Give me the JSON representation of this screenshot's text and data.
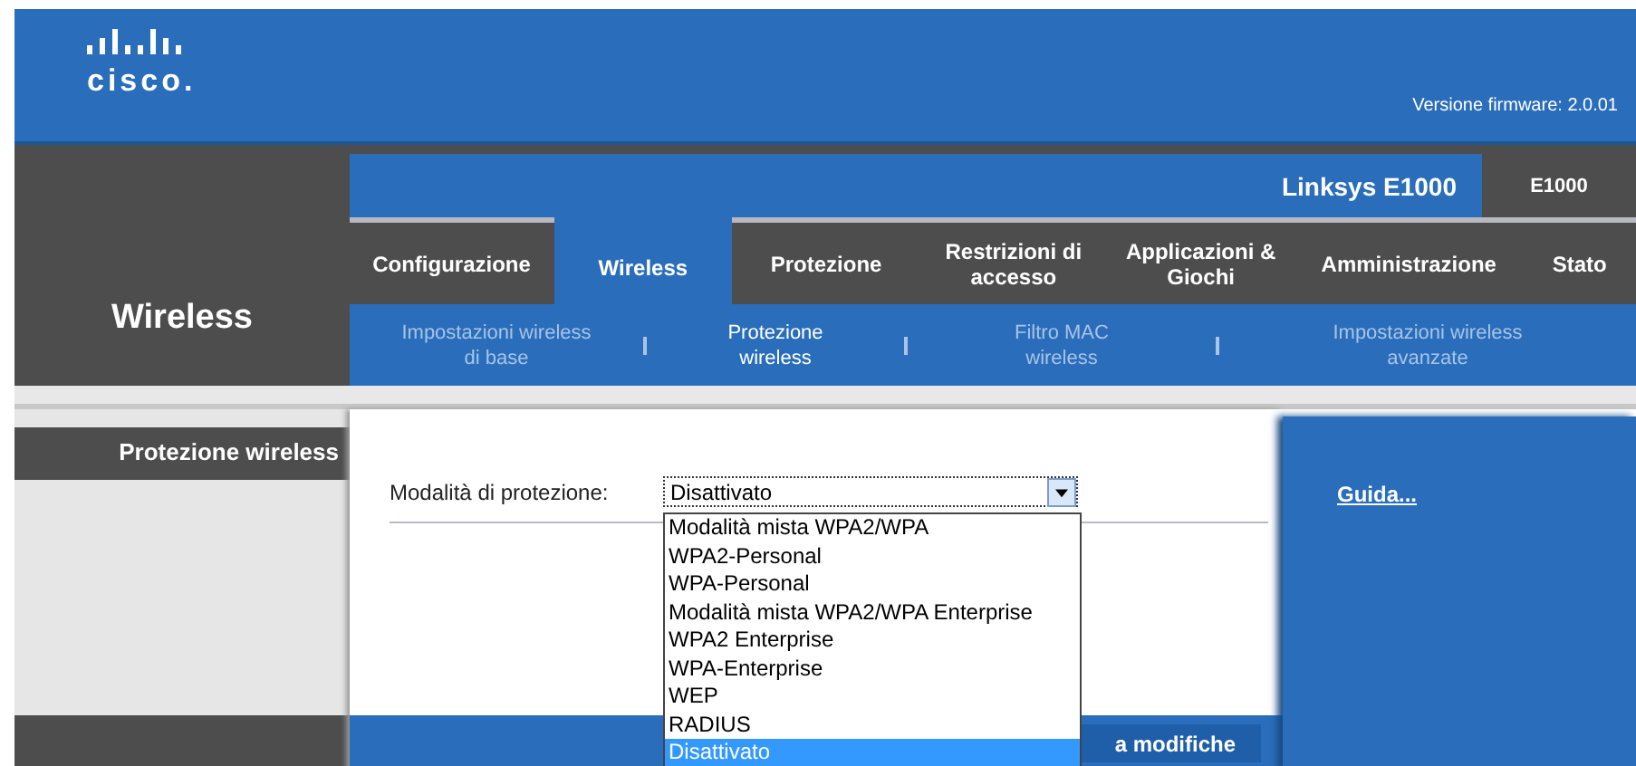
{
  "header": {
    "logo": "cisco.",
    "firmware": "Versione firmware: 2.0.01"
  },
  "model": {
    "name": "Linksys E1000",
    "code": "E1000"
  },
  "section_title": "Wireless",
  "tabs": [
    {
      "label": "Configurazione",
      "selected": false
    },
    {
      "label": "Wireless",
      "selected": true
    },
    {
      "label": "Protezione",
      "selected": false
    },
    {
      "label": "Restrizioni di accesso",
      "selected": false
    },
    {
      "label": "Applicazioni & Giochi",
      "selected": false
    },
    {
      "label": "Amministrazione",
      "selected": false
    },
    {
      "label": "Stato",
      "selected": false
    }
  ],
  "subtabs": [
    {
      "label": "Impostazioni wireless di base",
      "selected": false
    },
    {
      "label": "Protezione wireless",
      "selected": true
    },
    {
      "label": "Filtro MAC wireless",
      "selected": false
    },
    {
      "label": "Impostazioni wireless avanzate",
      "selected": false
    }
  ],
  "sidebar": {
    "title": "Protezione wireless"
  },
  "form": {
    "label": "Modalità di protezione:",
    "value": "Disattivato",
    "options": [
      {
        "label": "Modalità mista WPA2/WPA",
        "selected": false
      },
      {
        "label": "WPA2-Personal",
        "selected": false
      },
      {
        "label": "WPA-Personal",
        "selected": false
      },
      {
        "label": "Modalità mista WPA2/WPA Enterprise",
        "selected": false
      },
      {
        "label": "WPA2 Enterprise",
        "selected": false
      },
      {
        "label": "WPA-Enterprise",
        "selected": false
      },
      {
        "label": "WEP",
        "selected": false
      },
      {
        "label": "RADIUS",
        "selected": false
      },
      {
        "label": "Disattivato",
        "selected": true
      }
    ]
  },
  "save_button": "a modifiche",
  "help_link": "Guida..."
}
